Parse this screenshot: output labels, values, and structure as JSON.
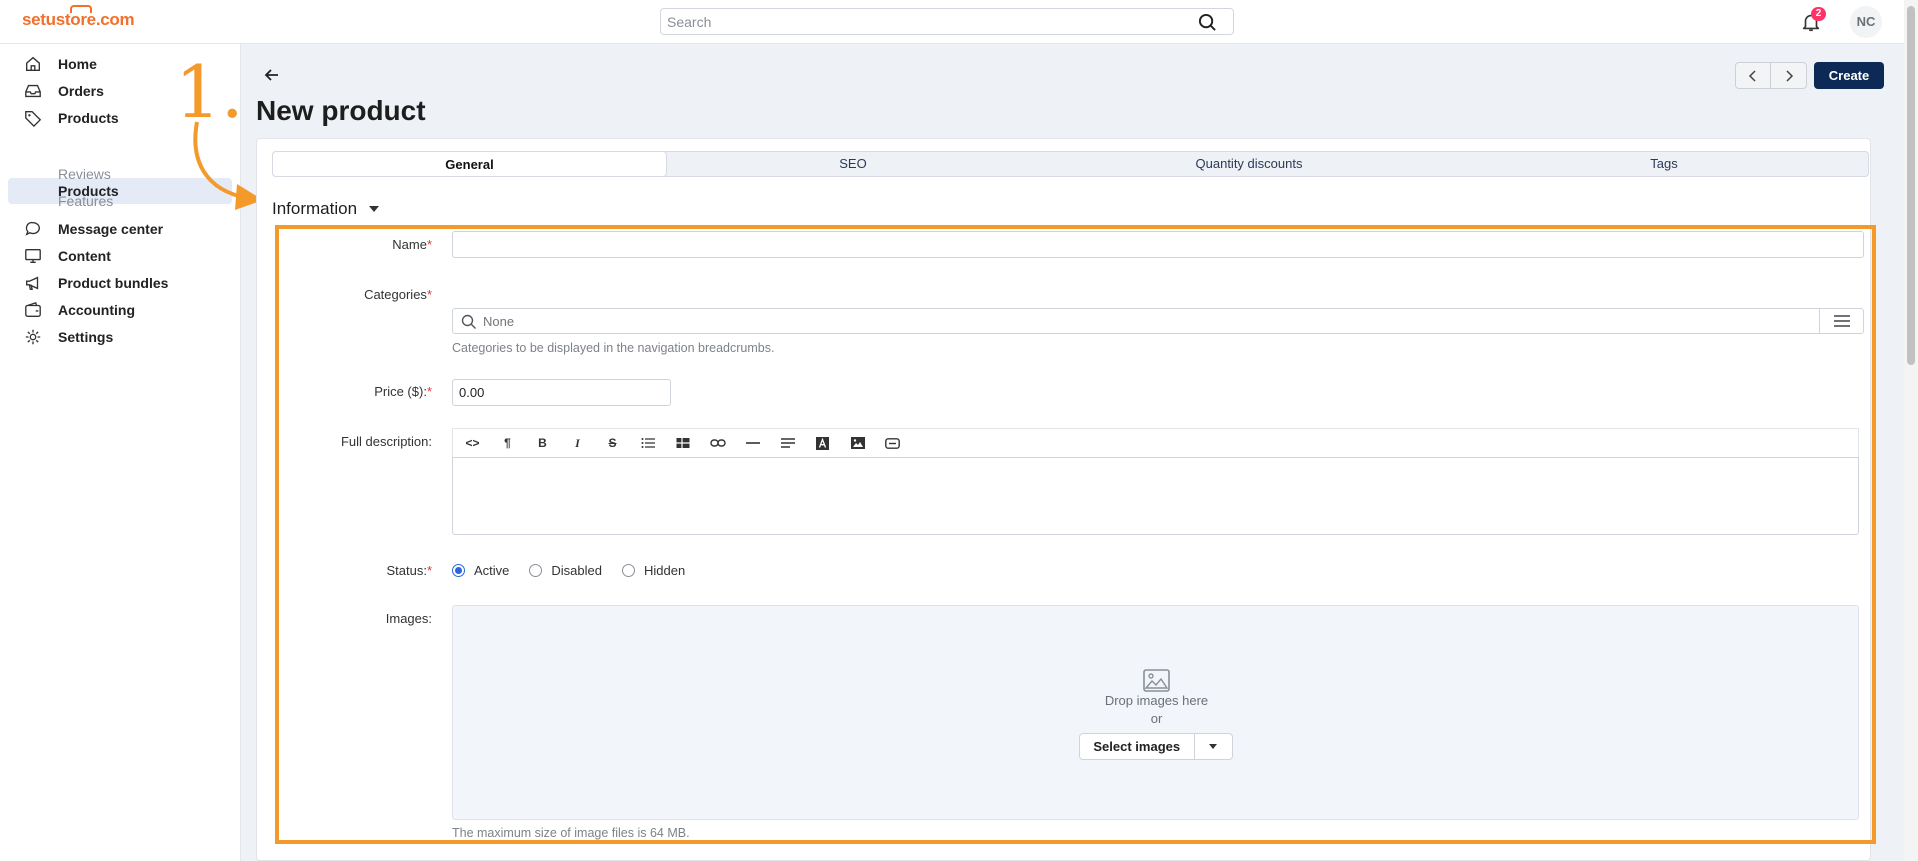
{
  "topbar": {
    "logo": "setustore.com",
    "search_placeholder": "Search",
    "notification_count": "2",
    "avatar_initials": "NC"
  },
  "sidebar": {
    "items": [
      {
        "label": "Home",
        "icon": "home-icon"
      },
      {
        "label": "Orders",
        "icon": "inbox-icon"
      },
      {
        "label": "Products",
        "icon": "tag-icon"
      },
      {
        "label": "Message center",
        "icon": "chat-icon"
      },
      {
        "label": "Content",
        "icon": "monitor-icon"
      },
      {
        "label": "Product bundles",
        "icon": "megaphone-icon"
      },
      {
        "label": "Accounting",
        "icon": "wallet-icon"
      },
      {
        "label": "Settings",
        "icon": "gear-icon"
      }
    ],
    "product_subitems": [
      "Products",
      "Reviews",
      "Features"
    ]
  },
  "annotation": {
    "step": "1."
  },
  "page": {
    "title": "New product",
    "create_label": "Create"
  },
  "tabs": [
    "General",
    "SEO",
    "Quantity discounts",
    "Tags"
  ],
  "section": {
    "title": "Information"
  },
  "form": {
    "name_label": "Name",
    "name_value": "",
    "categories_label": "Categories",
    "categories_placeholder": "None",
    "categories_help": "Categories to be displayed in the navigation breadcrumbs.",
    "price_label": "Price ($):",
    "price_value": "0.00",
    "description_label": "Full description:",
    "status_label": "Status:",
    "status_options": [
      "Active",
      "Disabled",
      "Hidden"
    ],
    "status_selected": "Active",
    "images_label": "Images:",
    "drop_text": "Drop images here",
    "or_text": "or",
    "select_images_label": "Select images",
    "images_help": "The maximum size of image files is 64 MB.",
    "required_mark": "*"
  },
  "colors": {
    "brand": "#f1702b",
    "primary_button": "#0d2a57",
    "annotation": "#f39a2b",
    "badge": "#ff3366"
  }
}
